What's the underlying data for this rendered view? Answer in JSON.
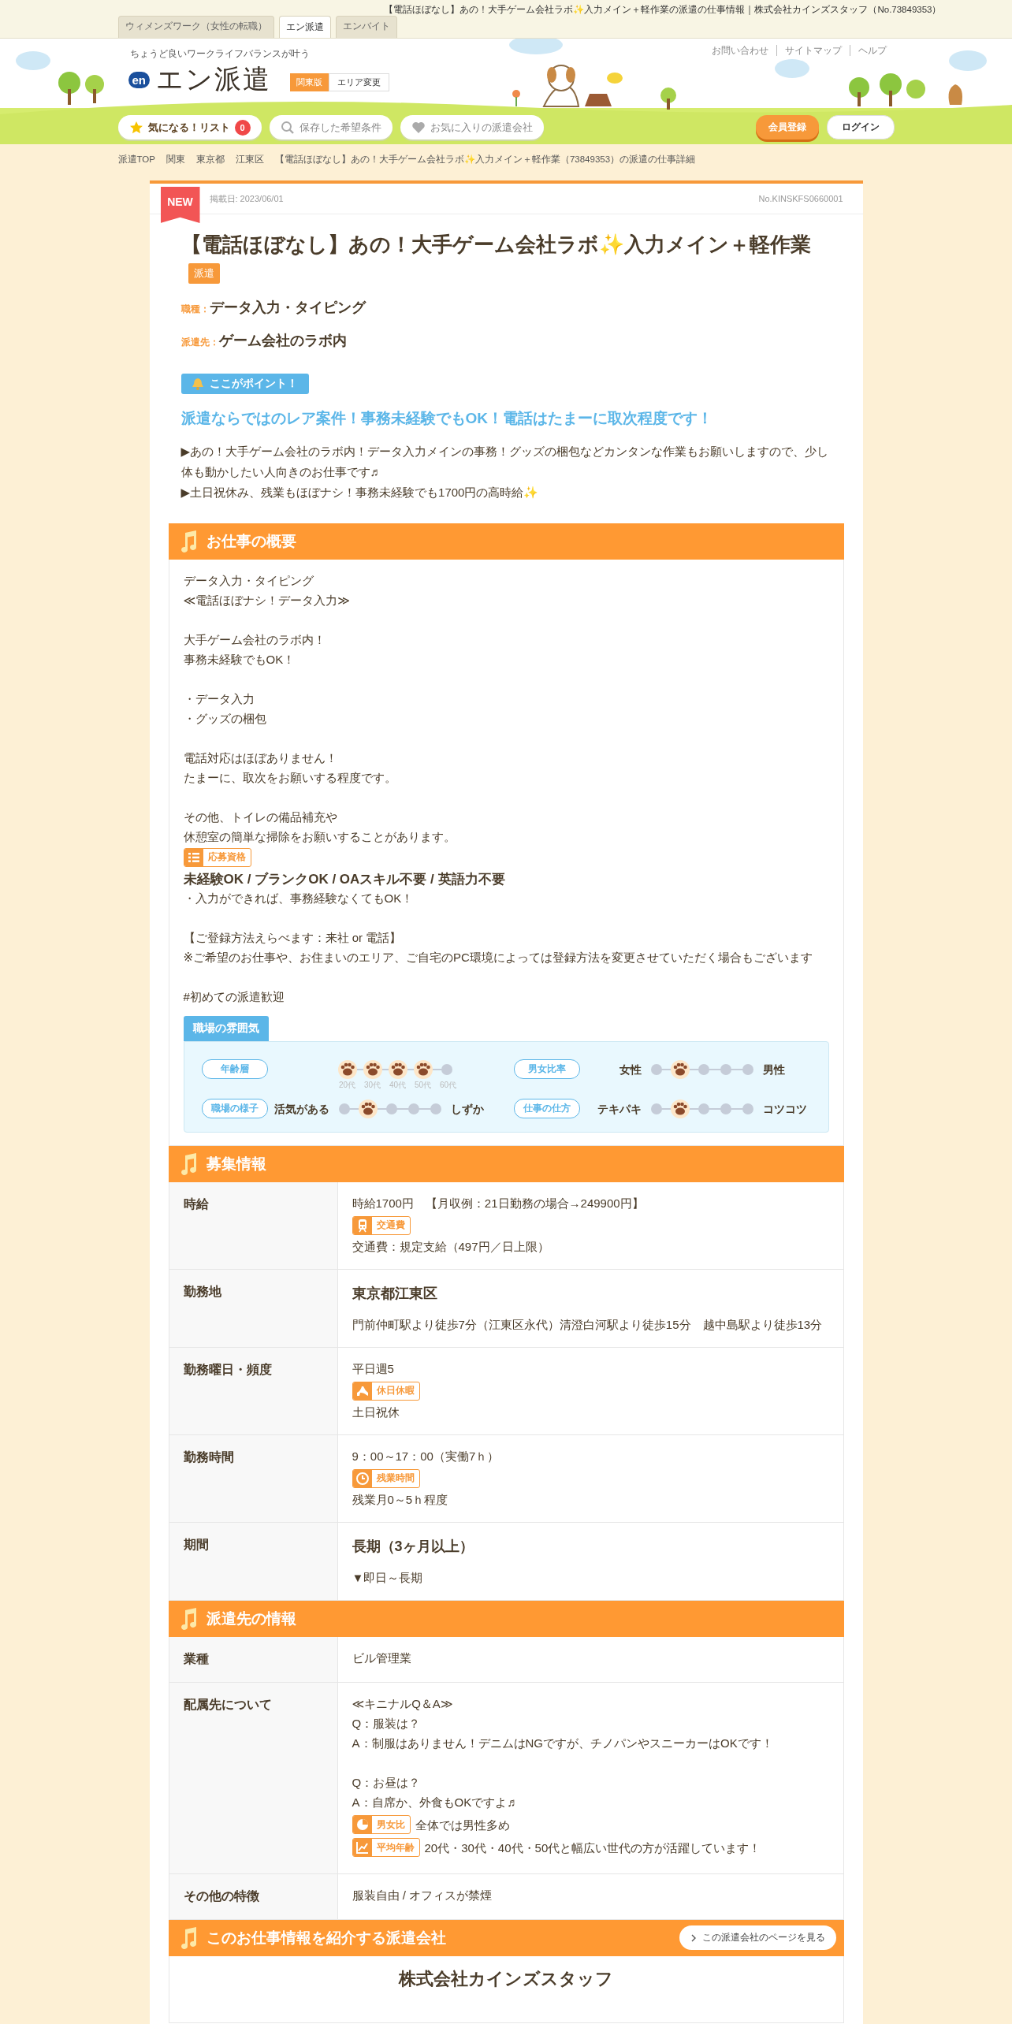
{
  "top_bar": {
    "page_title": "【電話ほぼなし】あの！大手ゲーム会社ラボ✨入力メイン＋軽作業の派遣の仕事情報｜株式会社カインズスタッフ（No.73849353）",
    "site_tabs": [
      {
        "label": "ウィメンズワーク（女性の転職）",
        "selected": false
      },
      {
        "label": "エン派遣",
        "selected": true
      },
      {
        "label": "エンバイト",
        "selected": false
      }
    ]
  },
  "header": {
    "tagline": "ちょうど良いワークライフバランスが叶う",
    "logo_mark": "en",
    "logo_text": "エン派遣",
    "region": "関東版",
    "region_change": "エリア変更",
    "utility_links": [
      "お問い合わせ",
      "サイトマップ",
      "ヘルプ"
    ],
    "nav": [
      {
        "label": "気になる！リスト",
        "badge": "0"
      },
      {
        "label": "保存した希望条件"
      },
      {
        "label": "お気に入りの派遣会社"
      }
    ],
    "register": "会員登録",
    "login": "ログイン"
  },
  "breadcrumb": [
    "派遣TOP",
    "関東",
    "東京都",
    "江東区",
    "【電話ほぼなし】あの！大手ゲーム会社ラボ✨入力メイン＋軽作業（73849353）の派遣の仕事詳細"
  ],
  "job": {
    "new_ribbon": "NEW",
    "posted": "掲載日: 2023/06/01",
    "number": "No.KINSKFS0660001",
    "title": "【電話ほぼなし】あの！大手ゲーム会社ラボ✨入力メイン＋軽作業",
    "type_tag": "派遣",
    "fields": [
      {
        "label": "職種：",
        "value": "データ入力・タイピング"
      },
      {
        "label": "派遣先：",
        "value": "ゲーム会社のラボ内"
      }
    ],
    "point_label": "ここがポイント！",
    "catch": "派遣ならではのレア案件！事務未経験でもOK！電話はたまーに取次程度です！",
    "points": [
      "▶あの！大手ゲーム会社のラボ内！データ入力メインの事務！グッズの梱包などカンタンな作業もお願いしますので、少し体も動かしたい人向きのお仕事です♬",
      "▶土日祝休み、残業もほぼナシ！事務未経験でも1700円の高時給✨"
    ]
  },
  "sections": [
    {
      "kind": "text",
      "title": "お仕事の概要",
      "blocks": [
        {
          "kind": "para",
          "lines": [
            "データ入力・タイピング",
            "≪電話ほぼナシ！データ入力≫"
          ]
        },
        {
          "kind": "para",
          "lines": [
            "大手ゲーム会社のラボ内！",
            "事務未経験でもOK！"
          ]
        },
        {
          "kind": "para",
          "lines": [
            "・データ入力",
            "・グッズの梱包"
          ]
        },
        {
          "kind": "para",
          "lines": [
            "電話対応はほぼありません！",
            "たまーに、取次をお願いする程度です。"
          ]
        },
        {
          "kind": "para",
          "lines": [
            "その他、トイレの備品補充や",
            "休憩室の簡単な掃除をお願いすることがあります。"
          ]
        },
        {
          "kind": "tag",
          "label": "応募資格"
        },
        {
          "kind": "heading",
          "text": "未経験OK / ブランクOK / OAスキル不要 / 英語力不要"
        },
        {
          "kind": "para",
          "lines": [
            "・入力ができれば、事務経験なくてもOK！"
          ]
        },
        {
          "kind": "para",
          "lines": [
            "【ご登録方法えらべます：来社 or 電話】",
            "※ご希望のお仕事や、お住まいのエリア、ご自宅のPC環境によっては登録方法を変更させていただく場合もございます"
          ]
        },
        {
          "kind": "para",
          "lines": [
            "#初めての派遣歓迎"
          ]
        }
      ],
      "atmosphere": {
        "title": "職場の雰囲気",
        "items": [
          {
            "kind": "ages",
            "label": "年齢層",
            "points": [
              {
                "label": "20代",
                "selected": true
              },
              {
                "label": "30代",
                "selected": true
              },
              {
                "label": "40代",
                "selected": true
              },
              {
                "label": "50代",
                "selected": true
              },
              {
                "label": "60代",
                "selected": false
              }
            ]
          },
          {
            "kind": "scale",
            "label": "男女比率",
            "left": "女性",
            "right": "男性",
            "level": 0.25
          },
          {
            "kind": "scale",
            "label": "職場の様子",
            "left": "活気がある",
            "right": "しずか",
            "level": 0.25
          },
          {
            "kind": "scale",
            "label": "仕事の仕方",
            "left": "テキパキ",
            "right": "コツコツ",
            "level": 0.25
          }
        ]
      }
    },
    {
      "kind": "table",
      "title": "募集情報",
      "rows": [
        {
          "label": "時給",
          "content": [
            {
              "kind": "text",
              "text": "時給1700円　【月収例：21日勤務の場合→249900円】"
            },
            {
              "kind": "tag",
              "label": "交通費"
            },
            {
              "kind": "text",
              "text": "交通費：規定支給（497円／日上限）"
            }
          ]
        },
        {
          "label": "勤務地",
          "content": [
            {
              "kind": "strong",
              "text": "東京都江東区"
            },
            {
              "kind": "text",
              "text": "門前仲町駅より徒歩7分（江東区永代）清澄白河駅より徒歩15分　越中島駅より徒歩13分"
            }
          ]
        },
        {
          "label": "勤務曜日・頻度",
          "content": [
            {
              "kind": "text",
              "text": "平日週5"
            },
            {
              "kind": "tag",
              "label": "休日休暇"
            },
            {
              "kind": "text",
              "text": "土日祝休"
            }
          ]
        },
        {
          "label": "勤務時間",
          "content": [
            {
              "kind": "text",
              "text": "9：00～17：00（実働7ｈ）"
            },
            {
              "kind": "tag",
              "label": "残業時間"
            },
            {
              "kind": "text",
              "text": "残業月0～5ｈ程度"
            }
          ]
        },
        {
          "label": "期間",
          "content": [
            {
              "kind": "strong",
              "text": "長期（3ヶ月以上）"
            },
            {
              "kind": "text",
              "text": "▼即日～長期"
            }
          ]
        }
      ]
    },
    {
      "kind": "table",
      "title": "派遣先の情報",
      "rows": [
        {
          "label": "業種",
          "content": [
            {
              "kind": "text",
              "text": "ビル管理業"
            }
          ]
        },
        {
          "label": "配属先について",
          "content": [
            {
              "kind": "lines",
              "lines": [
                "≪キニナルQ＆A≫",
                "Q：服装は？",
                "A：制服はありません！デニムはNGですが、チノパンやスニーカーはOKです！"
              ]
            },
            {
              "kind": "lines",
              "lines": [
                "Q：お昼は？",
                "A：自席か、外食もOKですよ♬"
              ]
            },
            {
              "kind": "tag",
              "label": "男女比",
              "text": "全体では男性多め"
            },
            {
              "kind": "tag",
              "label": "平均年齢",
              "text": "20代・30代・40代・50代と幅広い世代の方が活躍しています！"
            }
          ]
        },
        {
          "label": "その他の特徴",
          "content": [
            {
              "kind": "text",
              "text": "服装自由 / オフィスが禁煙"
            }
          ]
        }
      ]
    },
    {
      "kind": "company",
      "title": "このお仕事情報を紹介する派遣会社",
      "link": "この派遣会社のページを見る",
      "name": "株式会社カインズスタッフ"
    }
  ]
}
